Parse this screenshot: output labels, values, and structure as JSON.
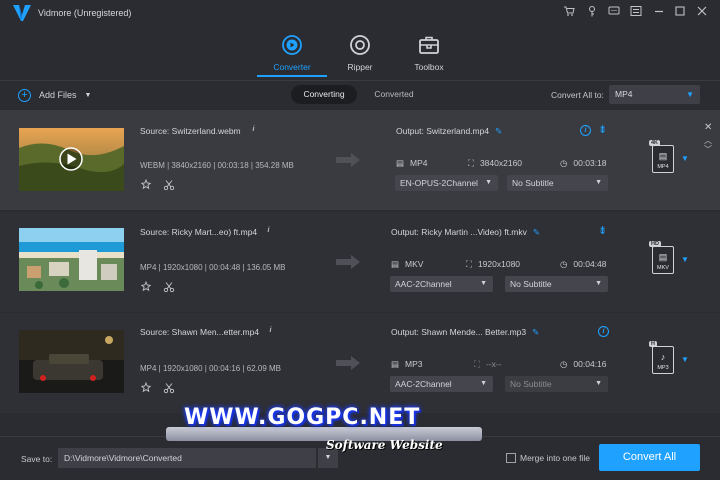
{
  "app": {
    "title": "Vidmore (Unregistered)"
  },
  "tabs": [
    {
      "label": "Converter",
      "icon": "converter-icon",
      "active": true
    },
    {
      "label": "Ripper",
      "icon": "ripper-icon",
      "active": false
    },
    {
      "label": "Toolbox",
      "icon": "toolbox-icon",
      "active": false
    }
  ],
  "toolbar": {
    "add_files": "Add Files",
    "converting": "Converting",
    "converted": "Converted",
    "convert_all_to": "Convert All to:",
    "format": "MP4"
  },
  "files": [
    {
      "source": "Source: Switzerland.webm",
      "meta": "WEBM | 3840x2160 | 00:03:18 | 354.28 MB",
      "output": "Output: Switzerland.mp4",
      "format": "MP4",
      "resolution": "3840x2160",
      "duration": "00:03:18",
      "audio": "EN-OPUS-2Channel",
      "subtitle": "No Subtitle",
      "badge_res": "4K",
      "badge_label": "MP4"
    },
    {
      "source": "Source: Ricky Mart...eo) ft.mp4",
      "meta": "MP4 | 1920x1080 | 00:04:48 | 136.05 MB",
      "output": "Output: Ricky Martin ...Video) ft.mkv",
      "format": "MKV",
      "resolution": "1920x1080",
      "duration": "00:04:48",
      "audio": "AAC-2Channel",
      "subtitle": "No Subtitle",
      "badge_res": "HD",
      "badge_label": "MKV"
    },
    {
      "source": "Source: Shawn Men...etter.mp4",
      "meta": "MP4 | 1920x1080 | 00:04:16 | 62.09 MB",
      "output": "Output: Shawn Mende... Better.mp3",
      "format": "MP3",
      "resolution": "--x--",
      "duration": "00:04:16",
      "audio": "AAC-2Channel",
      "subtitle": "No Subtitle",
      "badge_res": "H",
      "badge_label": "MP3"
    }
  ],
  "bottom": {
    "save_to": "Save to:",
    "path": "D:\\Vidmore\\Vidmore\\Converted",
    "merge": "Merge into one file",
    "convert_all": "Convert All"
  },
  "watermark": {
    "main": "WWW.GOGPC.NET",
    "sub": "Software Website"
  },
  "colors": {
    "accent": "#1fa2ff",
    "background": "#2b2c31",
    "row_selected": "#3a3b41"
  }
}
